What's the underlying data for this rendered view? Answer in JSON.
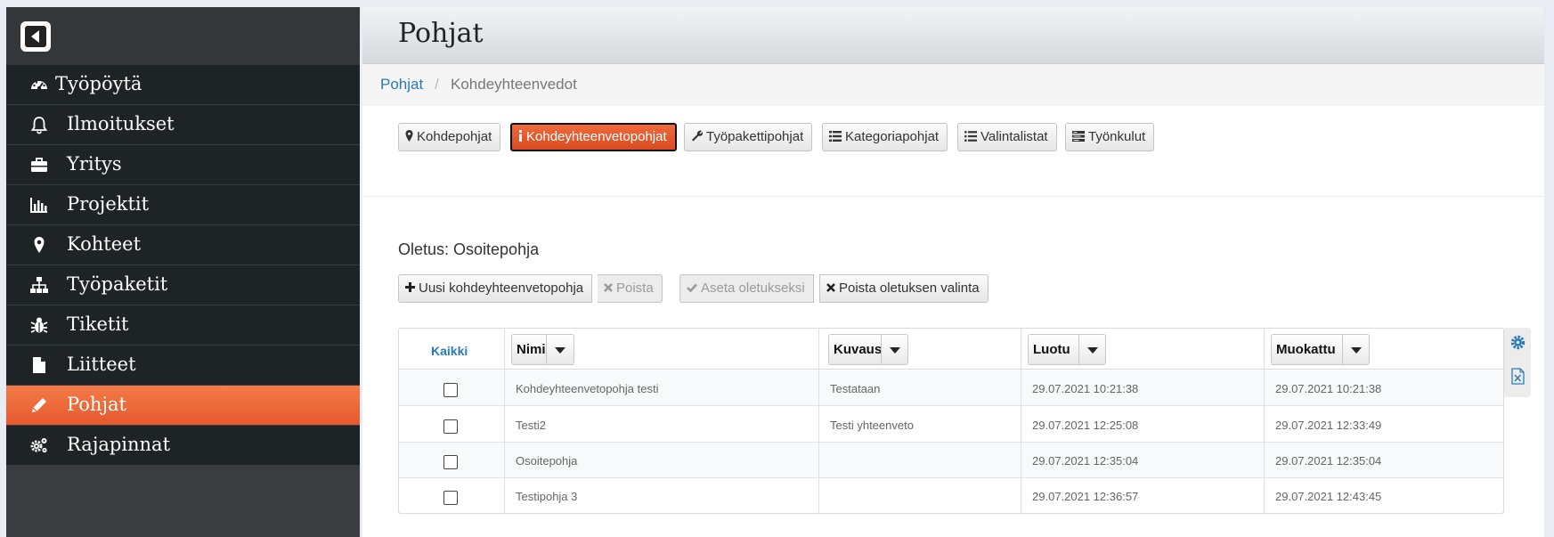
{
  "sidebar": {
    "items": [
      {
        "label": "Työpöytä",
        "icon": "dashboard-icon",
        "active": false
      },
      {
        "label": "Ilmoitukset",
        "icon": "bell-icon",
        "active": false
      },
      {
        "label": "Yritys",
        "icon": "briefcase-icon",
        "active": false
      },
      {
        "label": "Projektit",
        "icon": "bar-chart-icon",
        "active": false
      },
      {
        "label": "Kohteet",
        "icon": "map-marker-icon",
        "active": false
      },
      {
        "label": "Työpaketit",
        "icon": "sitemap-icon",
        "active": false
      },
      {
        "label": "Tiketit",
        "icon": "bug-icon",
        "active": false
      },
      {
        "label": "Liitteet",
        "icon": "file-icon",
        "active": false
      },
      {
        "label": "Pohjat",
        "icon": "pencil-icon",
        "active": true
      },
      {
        "label": "Rajapinnat",
        "icon": "cogs-icon",
        "active": false
      }
    ]
  },
  "header": {
    "title": "Pohjat"
  },
  "breadcrumb": {
    "root": "Pohjat",
    "separator": "/",
    "current": "Kohdeyhteenvedot"
  },
  "tabs": [
    {
      "label": "Kohdepohjat",
      "icon": "map-marker-icon"
    },
    {
      "label": "Kohdeyhteenvetopohjat",
      "icon": "info-icon",
      "active": true
    },
    {
      "label": "Työpakettipohjat",
      "icon": "wrench-icon"
    },
    {
      "label": "Kategoriapohjat",
      "icon": "list-icon"
    },
    {
      "label": "Valintalistat",
      "icon": "list-ul-icon"
    },
    {
      "label": "Työnkulut",
      "icon": "tasks-icon"
    }
  ],
  "default_template": "Oletus: Osoitepohja",
  "actions": {
    "new": "Uusi kohdeyhteenvetopohja",
    "delete": "Poista",
    "set_default": "Aseta oletukseksi",
    "clear_default": "Poista oletuksen valinta"
  },
  "table": {
    "select_all": "Kaikki",
    "columns": [
      "Nimi",
      "Kuvaus",
      "Luotu",
      "Muokattu"
    ],
    "rows": [
      {
        "name": "Kohdeyhteenvetopohja testi",
        "description": "Testataan",
        "created": "29.07.2021 10:21:38",
        "modified": "29.07.2021 10:21:38"
      },
      {
        "name": "Testi2",
        "description": "Testi yhteenveto",
        "created": "29.07.2021 12:25:08",
        "modified": "29.07.2021 12:33:49"
      },
      {
        "name": "Osoitepohja",
        "description": "",
        "created": "29.07.2021 12:35:04",
        "modified": "29.07.2021 12:35:04"
      },
      {
        "name": "Testipohja 3",
        "description": "",
        "created": "29.07.2021 12:36:57",
        "modified": "29.07.2021 12:43:45"
      }
    ]
  },
  "colors": {
    "accent": "#e6582b",
    "link": "#2a7ab8",
    "sidebar_bg": "#1e2325"
  }
}
